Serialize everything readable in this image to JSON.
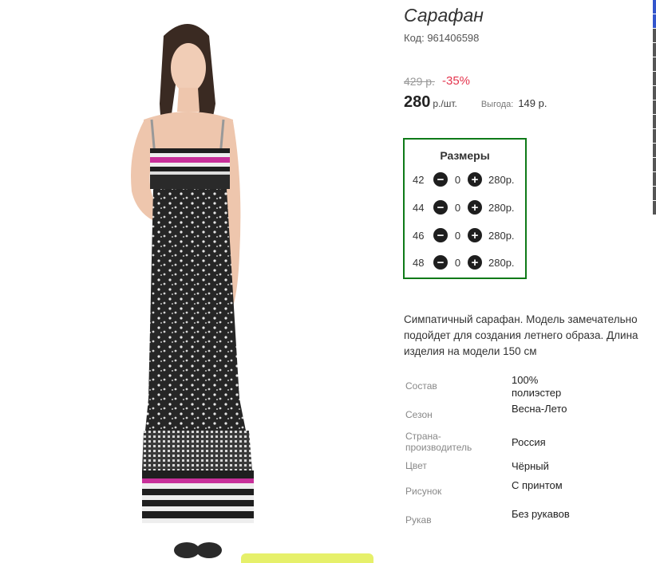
{
  "product": {
    "title": "Сарафан",
    "code": "Код: 961406598",
    "old_price": "429 р.",
    "discount": "-35%",
    "price": "280",
    "unit": "р./шт.",
    "savings_label": "Выгода:",
    "savings_value": "149 р."
  },
  "sizes": {
    "title": "Размеры",
    "rows": [
      {
        "size": "42",
        "qty": "0",
        "price": "280р."
      },
      {
        "size": "44",
        "qty": "0",
        "price": "280р."
      },
      {
        "size": "46",
        "qty": "0",
        "price": "280р."
      },
      {
        "size": "48",
        "qty": "0",
        "price": "280р."
      }
    ]
  },
  "description": "Симпатичный сарафан. Модель замечательно подойдет для создания летнего образа. Длина изделия на модели 150 см",
  "properties": [
    {
      "label": "Состав",
      "value": "100% полиэстер"
    },
    {
      "label": "Сезон",
      "value": "Весна-Лето"
    },
    {
      "label": "Страна-производитель",
      "value": "Россия"
    },
    {
      "label": "Цвет",
      "value": "Чёрный"
    },
    {
      "label": "Рисунок",
      "value": "С принтом"
    },
    {
      "label": "Рукав",
      "value": "Без рукавов"
    }
  ],
  "icons": {
    "minus": "minus-circle-icon",
    "plus": "plus-circle-icon"
  },
  "colors": {
    "discount": "#e4344d",
    "sizes_border": "#0e7a18",
    "dress_accent": "#c8309a"
  }
}
